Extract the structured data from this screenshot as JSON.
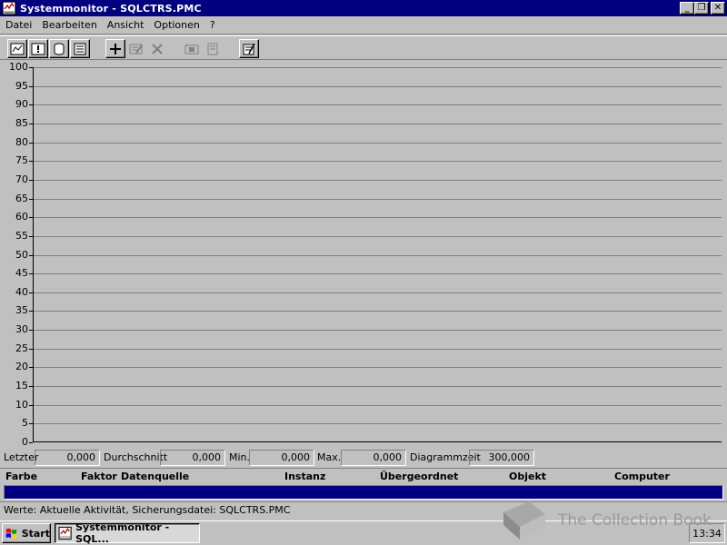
{
  "window": {
    "title": "Systemmonitor - SQLCTRS.PMC",
    "minimize": "_",
    "restore": "❐",
    "close": "✕"
  },
  "menu": [
    {
      "label": "Datei"
    },
    {
      "label": "Bearbeiten"
    },
    {
      "label": "Ansicht"
    },
    {
      "label": "Optionen"
    },
    {
      "label": "?"
    }
  ],
  "toolbar": {
    "icons": [
      "chart-view-icon",
      "alert-view-icon",
      "log-view-icon",
      "report-view-icon",
      "add-counter-icon",
      "edit-counter-icon",
      "delete-counter-icon",
      "time-window-icon",
      "bookmark-icon",
      "options-icon"
    ]
  },
  "chart_data": {
    "type": "line",
    "y_ticks": [
      100,
      95,
      90,
      85,
      80,
      75,
      70,
      65,
      60,
      55,
      50,
      45,
      40,
      35,
      30,
      25,
      20,
      15,
      10,
      5,
      0
    ],
    "ylim": [
      0,
      100
    ],
    "series": [],
    "grid": true
  },
  "stats": {
    "last_label": "Letzter",
    "last_value": "0,000",
    "avg_label": "Durchschnitt",
    "avg_value": "0,000",
    "min_label": "Min.",
    "min_value": "0,000",
    "max_label": "Max.",
    "max_value": "0,000",
    "time_label": "Diagrammzeit",
    "time_value": "300,000"
  },
  "legend": {
    "columns": [
      "Farbe",
      "Faktor",
      "Datenquelle",
      "Instanz",
      "Übergeordnet",
      "Objekt",
      "Computer"
    ],
    "selected_color": "#000080"
  },
  "status": {
    "text": "Werte: Aktuelle Aktivität, Sicherungsdatei: SQLCTRS.PMC"
  },
  "taskbar": {
    "start_label": "Start",
    "task_label": "Systemmonitor - SQL...",
    "clock": "13:34"
  },
  "watermark": {
    "text": "The Collection Book"
  }
}
